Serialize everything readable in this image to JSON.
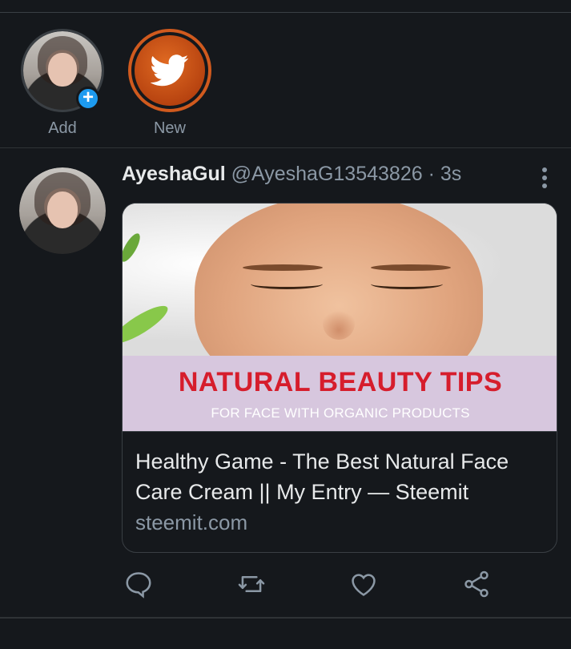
{
  "fleets": {
    "add": {
      "label": "Add",
      "plus": "+"
    },
    "new": {
      "label": "New",
      "icon": "twitter-bird-icon"
    }
  },
  "tweet": {
    "name": "AyeshaGul",
    "handle": "@AyeshaG13543826",
    "separator": "·",
    "time": "3s",
    "card": {
      "image_title": "NATURAL BEAUTY TIPS",
      "image_subtitle": "FOR FACE WITH ORGANIC PRODUCTS",
      "title": "Healthy Game - The Best Natural Face Care Cream || My Entry — Steemit",
      "domain": "steemit.com"
    },
    "actions": [
      "reply-icon",
      "retweet-icon",
      "like-icon",
      "share-icon"
    ]
  },
  "colors": {
    "background": "#15181c",
    "accent": "#1d9bf0",
    "fleet_ring": "#d05a1e",
    "secondary_text": "#8b98a5",
    "banner_title": "#d61d2c"
  }
}
